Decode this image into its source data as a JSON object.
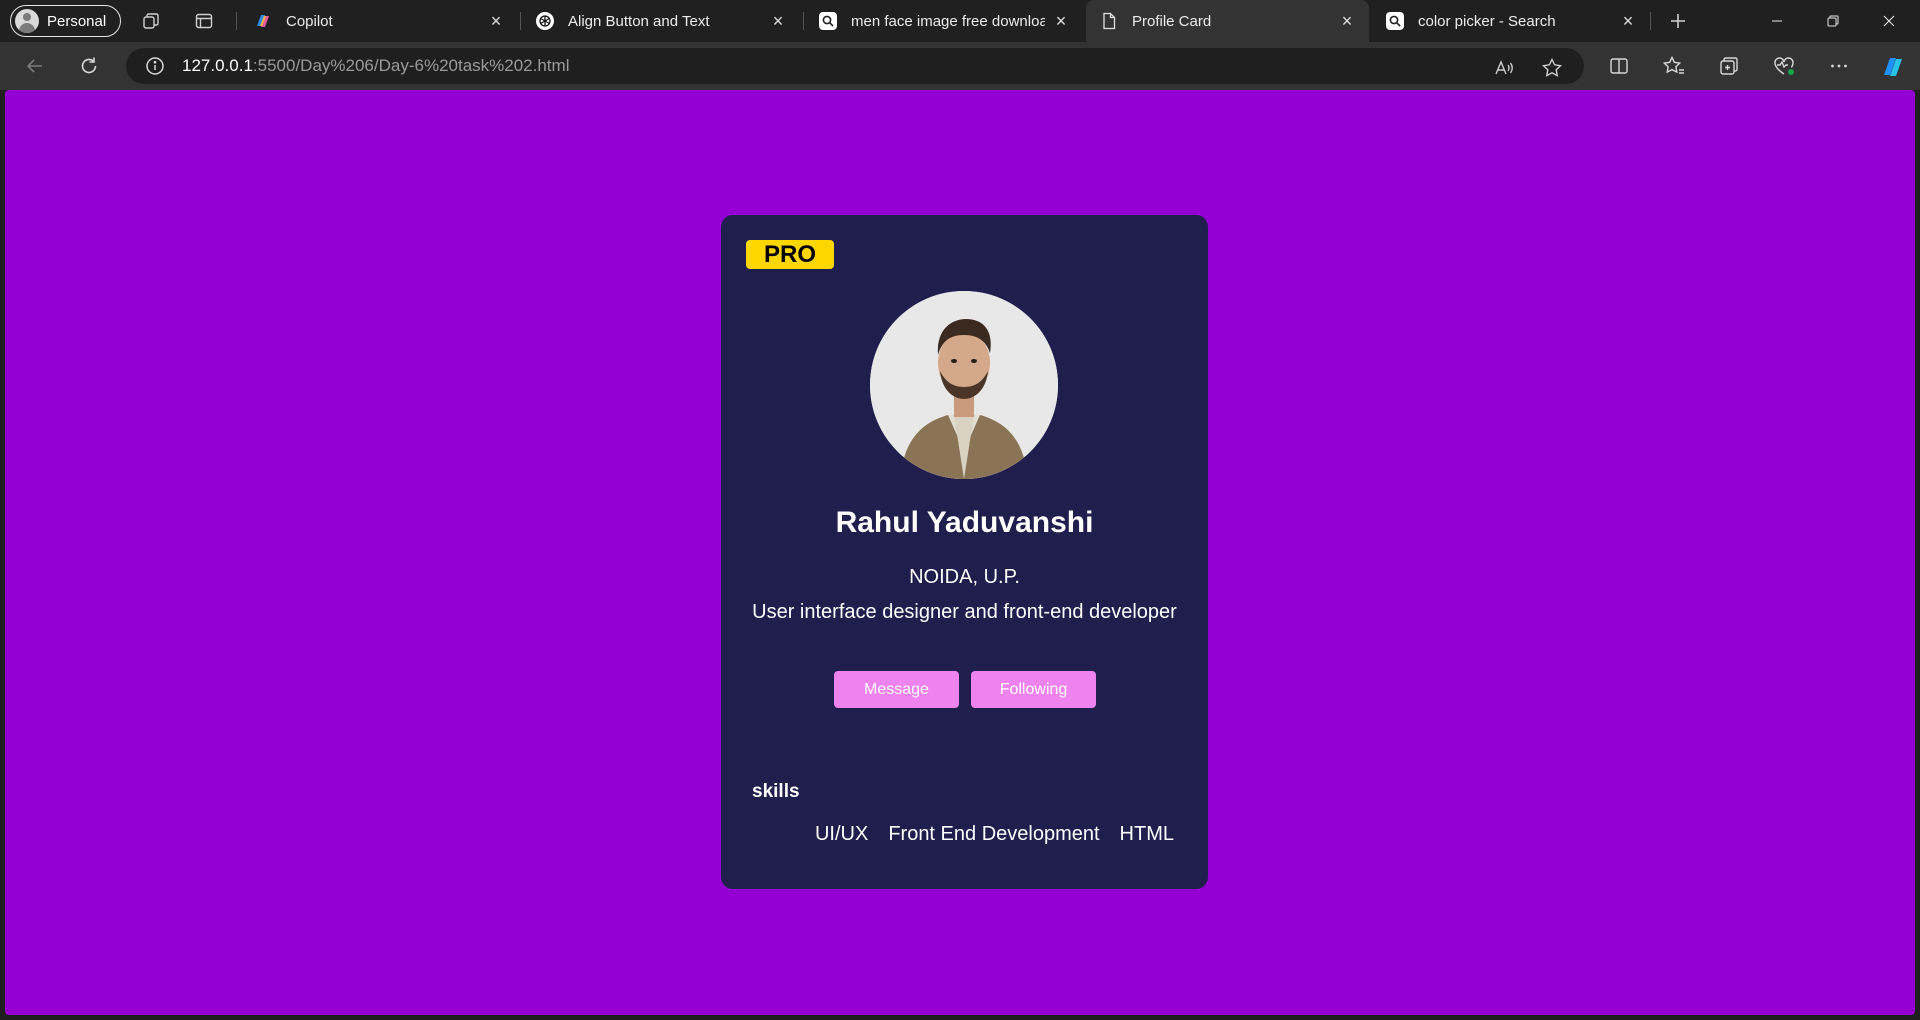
{
  "browser": {
    "profile_label": "Personal",
    "tabs": [
      {
        "title": "Copilot",
        "icon": "copilot-icon",
        "active": false
      },
      {
        "title": "Align Button and Text",
        "icon": "chatgpt-icon",
        "active": false
      },
      {
        "title": "men face image free download",
        "icon": "bing-search-icon",
        "active": false
      },
      {
        "title": "Profile Card",
        "icon": "page-icon",
        "active": true
      },
      {
        "title": "color picker - Search",
        "icon": "bing-search-icon",
        "active": false
      }
    ],
    "url": {
      "host": "127.0.0.1",
      "rest": ":5500/Day%206/Day-6%20task%202.html"
    }
  },
  "card": {
    "badge": "PRO",
    "name": "Rahul Yaduvanshi",
    "location": "NOIDA, U.P.",
    "bio": "User interface designer and front-end developer",
    "buttons": {
      "message": "Message",
      "following": "Following"
    },
    "skills_title": "skills",
    "skills": [
      "UI/UX",
      "Front End Development",
      "HTML"
    ]
  },
  "colors": {
    "page_bg": "#9400d3",
    "card_bg": "#1f1e4d",
    "badge_bg": "#ffd700",
    "button_bg": "#ee82ee"
  }
}
